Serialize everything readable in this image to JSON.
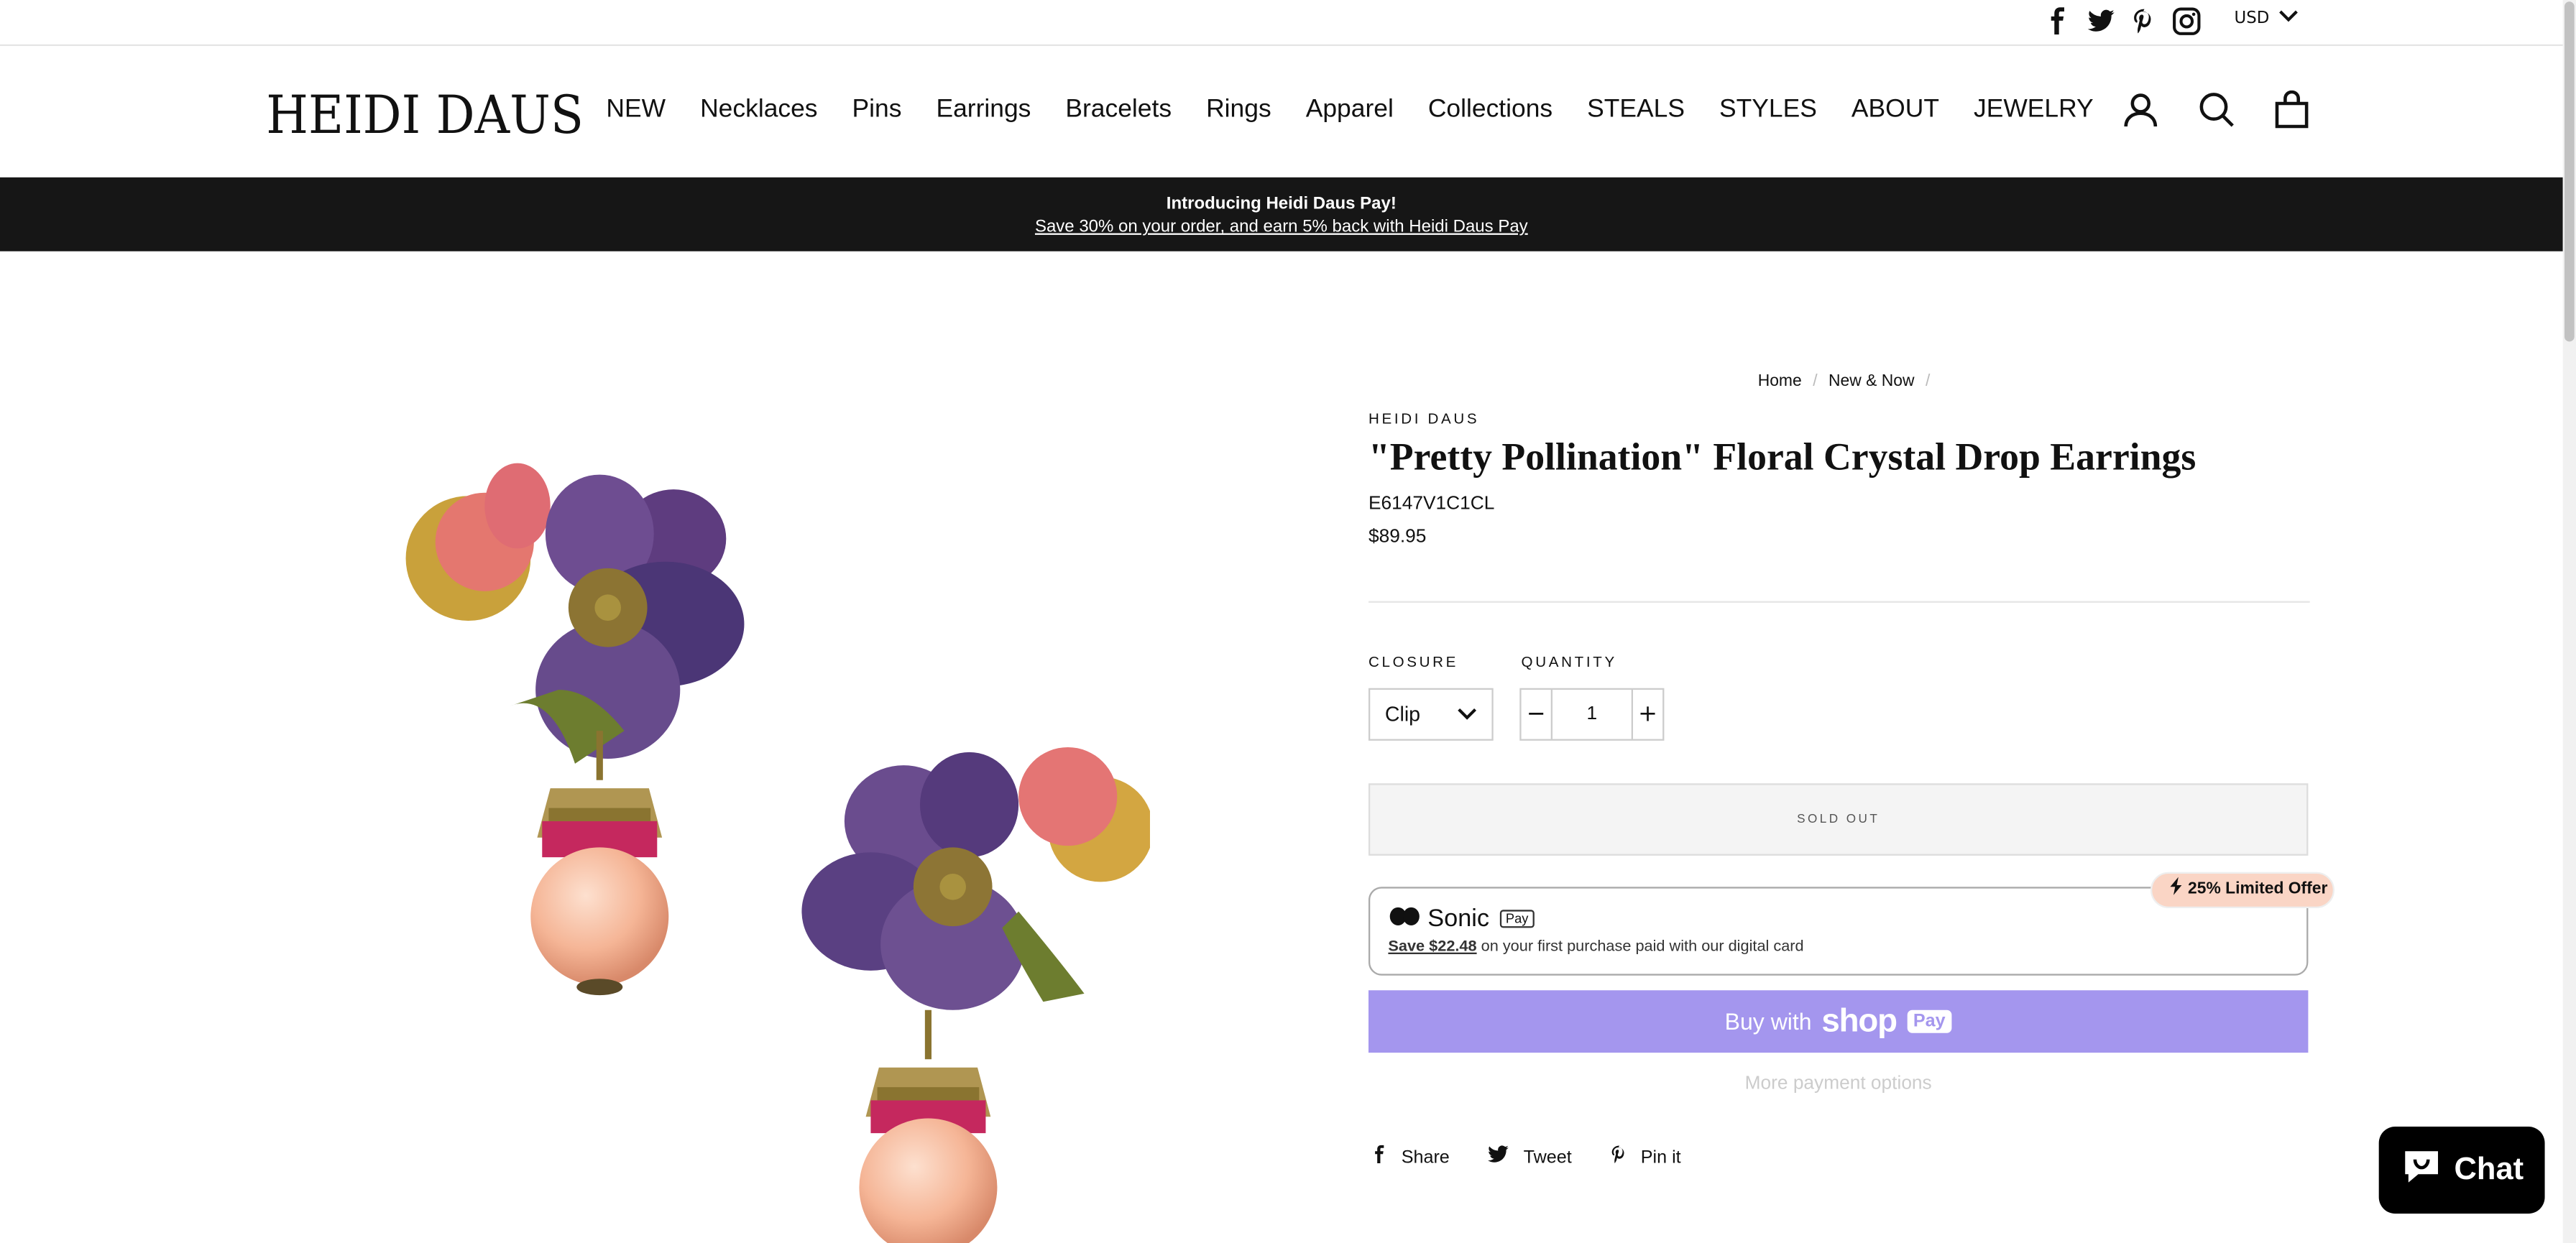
{
  "util": {
    "social_icons": [
      "facebook-icon",
      "twitter-icon",
      "pinterest-icon",
      "instagram-icon"
    ],
    "currency": "USD"
  },
  "header": {
    "logo": "HEIDI DAUS",
    "nav": [
      "NEW",
      "Necklaces",
      "Pins",
      "Earrings",
      "Bracelets",
      "Rings",
      "Apparel",
      "Collections",
      "STEALS",
      "STYLES",
      "ABOUT",
      "JEWELRY"
    ],
    "icons": [
      "account-icon",
      "search-icon",
      "cart-icon"
    ]
  },
  "announcement": {
    "title": "Introducing Heidi Daus Pay!",
    "link": "Save 30% on your order, and earn 5% back with Heidi Daus Pay"
  },
  "breadcrumb": {
    "home": "Home",
    "section": "New & Now",
    "sep": "/"
  },
  "product": {
    "vendor": "HEIDI DAUS",
    "title": "\"Pretty Pollination\" Floral Crystal Drop Earrings",
    "sku": "E6147V1C1CL",
    "price": "$89.95",
    "closure_label": "CLOSURE",
    "closure_value": "Clip",
    "quantity_label": "QUANTITY",
    "quantity": "1",
    "minus": "−",
    "plus": "+",
    "sold_out": "SOLD OUT"
  },
  "sonic": {
    "brand": "Sonic",
    "pay_tag": "Pay",
    "save": "Save $22.48",
    "sub": " on your first purchase paid with our digital card",
    "offer": "25% Limited Offer"
  },
  "shop_pay": {
    "prefix": "Buy with",
    "shop": "shop",
    "pay": "Pay"
  },
  "more_payment": "More payment options",
  "social_share": {
    "share": "Share",
    "tweet": "Tweet",
    "pin": "Pin it"
  },
  "chat": {
    "label": "Chat"
  },
  "colors": {
    "announce_bg": "#161616",
    "shop_pay": "#a496ee",
    "offer_bg": "#fad5c5"
  }
}
